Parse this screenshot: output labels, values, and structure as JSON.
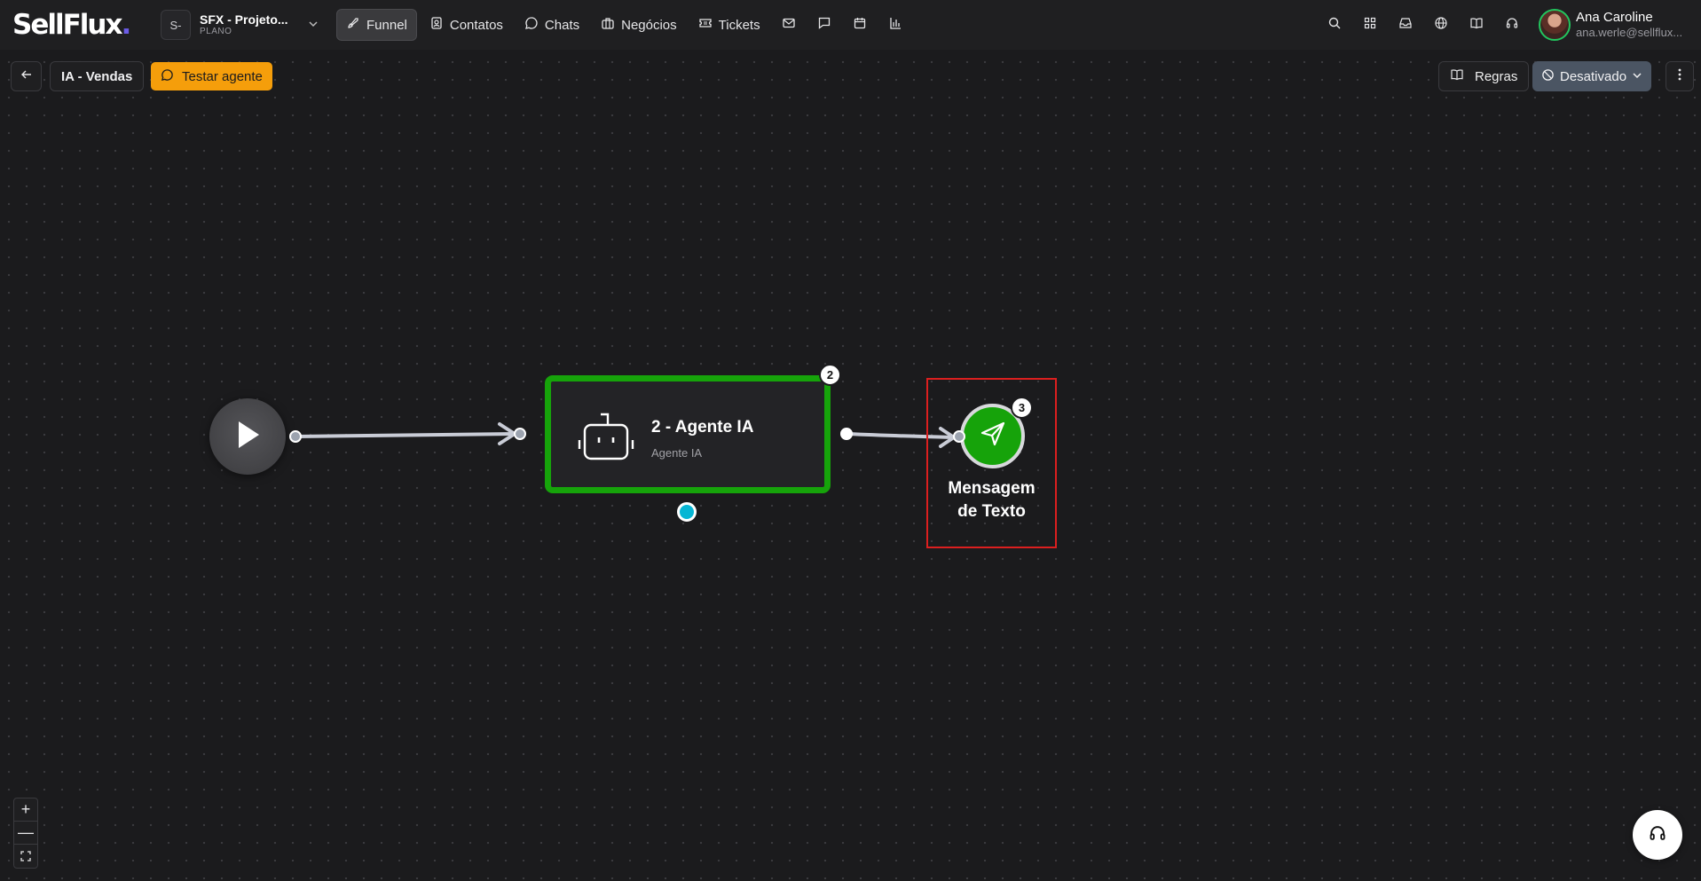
{
  "app": {
    "logo_text": "SellFlux",
    "logo_dot": "."
  },
  "project": {
    "badge": "S-",
    "name": "SFX - Projeto...",
    "plan": "PLANO"
  },
  "nav": {
    "items": [
      {
        "label": "Funnel",
        "icon": "rocket-icon",
        "active": true
      },
      {
        "label": "Contatos",
        "icon": "contacts-icon"
      },
      {
        "label": "Chats",
        "icon": "chat-bubble-icon"
      },
      {
        "label": "Negócios",
        "icon": "briefcase-icon"
      },
      {
        "label": "Tickets",
        "icon": "ticket-icon"
      }
    ],
    "icon_items": [
      "mail-icon",
      "message-square-icon",
      "calendar-icon",
      "bar-chart-icon"
    ]
  },
  "header_icons": [
    "search-icon",
    "apps-grid-icon",
    "inbox-icon",
    "globe-icon",
    "book-icon",
    "headset-icon"
  ],
  "user": {
    "name": "Ana Caroline",
    "email": "ana.werle@sellflux..."
  },
  "toolbar": {
    "flow_name": "IA - Vendas",
    "test_label": "Testar agente",
    "rules_label": "Regras",
    "status_label": "Desativado"
  },
  "nodes": {
    "agent": {
      "badge": "2",
      "title": "2 - Agente IA",
      "subtitle": "Agente IA"
    },
    "message": {
      "badge": "3",
      "label_line1": "Mensagem",
      "label_line2": "de Texto"
    }
  },
  "zoom": {
    "in": "+",
    "out": "—"
  },
  "colors": {
    "accent_green": "#16a30a",
    "test_button": "#f59e0b",
    "highlight_frame": "#dc1f1f",
    "handle_cyan": "#06b6d4",
    "status_bg": "#4b5563"
  }
}
